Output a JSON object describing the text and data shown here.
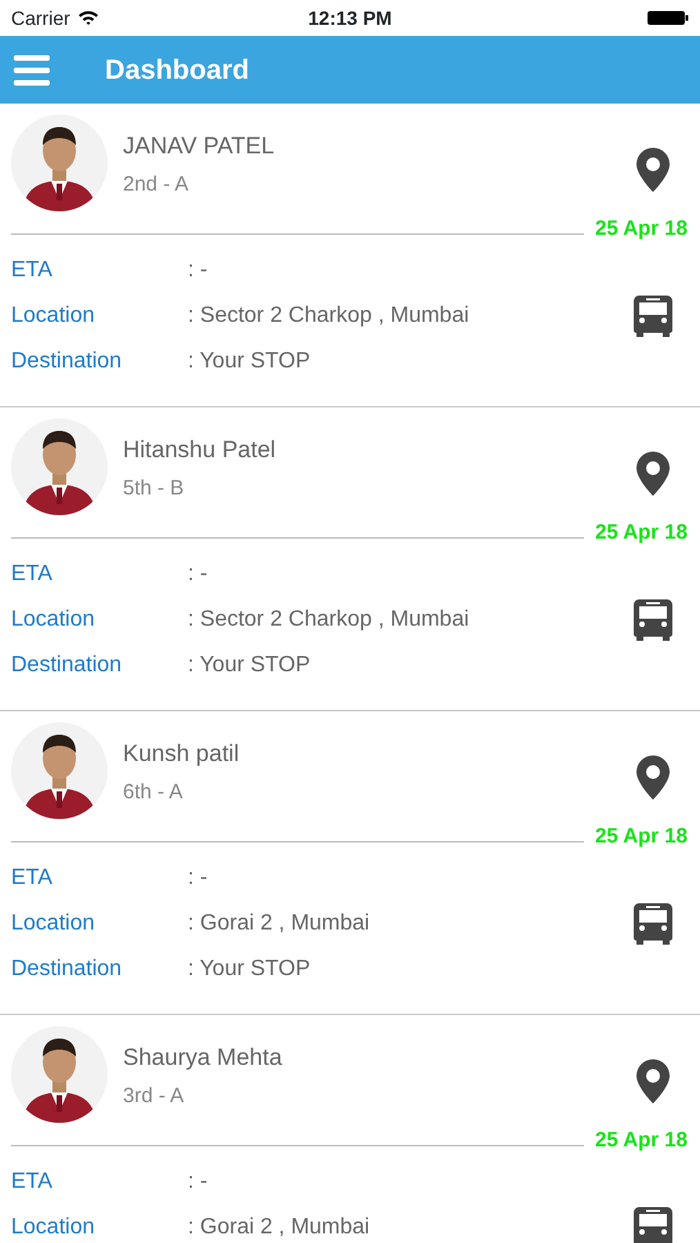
{
  "status_bar": {
    "carrier": "Carrier",
    "time": "12:13 PM"
  },
  "nav": {
    "title": "Dashboard"
  },
  "students": [
    {
      "name": "JANAV PATEL",
      "class": "2nd - A",
      "date": "25 Apr 18",
      "rows": [
        {
          "label": "ETA",
          "value": ": -"
        },
        {
          "label": "Location",
          "value": ": Sector 2 Charkop , Mumbai"
        },
        {
          "label": "Destination",
          "value": ": Your STOP"
        }
      ]
    },
    {
      "name": "Hitanshu Patel",
      "class": "5th - B",
      "date": "25 Apr 18",
      "rows": [
        {
          "label": "ETA",
          "value": ": -"
        },
        {
          "label": "Location",
          "value": ": Sector 2 Charkop , Mumbai"
        },
        {
          "label": "Destination",
          "value": ": Your STOP"
        }
      ]
    },
    {
      "name": "Kunsh patil",
      "class": "6th - A",
      "date": "25 Apr 18",
      "rows": [
        {
          "label": "ETA",
          "value": ": -"
        },
        {
          "label": "Location",
          "value": ": Gorai 2 , Mumbai"
        },
        {
          "label": "Destination",
          "value": ": Your STOP"
        }
      ]
    },
    {
      "name": "Shaurya Mehta",
      "class": "3rd - A",
      "date": "25 Apr 18",
      "rows": [
        {
          "label": "ETA",
          "value": ": -"
        },
        {
          "label": "Location",
          "value": ": Gorai 2 , Mumbai"
        }
      ]
    }
  ]
}
